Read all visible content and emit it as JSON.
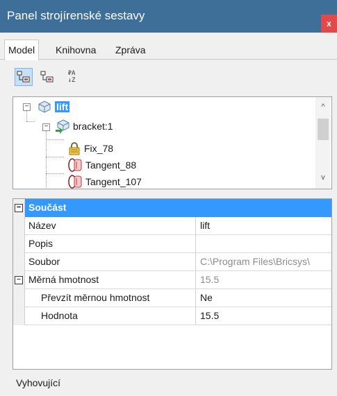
{
  "window": {
    "title": "Panel strojírenské sestavy",
    "close_label": "x",
    "colors": {
      "titlebar": "#3d6f99",
      "close": "#e04a4a",
      "selection": "#3399ff"
    }
  },
  "tabs": [
    {
      "label": "Model",
      "active": true
    },
    {
      "label": "Knihovna",
      "active": false
    },
    {
      "label": "Zpráva",
      "active": false
    }
  ],
  "toolbar": {
    "buttons": [
      {
        "icon": "tree-view-icon",
        "active": true
      },
      {
        "icon": "tree-view-alt-icon",
        "active": false
      },
      {
        "icon": "sort-az-icon",
        "active": false
      }
    ],
    "sort_glyph_top": "₽A",
    "sort_glyph_bottom": "↓Z"
  },
  "tree": {
    "nodes": [
      {
        "label": "lift",
        "icon": "assembly-icon",
        "selected": true
      },
      {
        "label": "bracket:1",
        "icon": "component-insert-icon",
        "selected": false
      },
      {
        "label": "Fix_78",
        "icon": "lock-constraint-icon",
        "selected": false
      },
      {
        "label": "Tangent_88",
        "icon": "tangent-constraint-icon",
        "selected": false
      },
      {
        "label": "Tangent_107",
        "icon": "tangent-constraint-icon",
        "selected": false
      }
    ],
    "expander_symbol": "−",
    "scroll_up": "^",
    "scroll_down": "v"
  },
  "properties": {
    "section_title": "Součást",
    "collapse_symbol": "−",
    "rows": [
      {
        "name": "Název",
        "value": "lift"
      },
      {
        "name": "Popis",
        "value": ""
      },
      {
        "name": "Soubor",
        "value": "C:\\Program Files\\Bricsys\\"
      },
      {
        "name": "Měrná hmotnost",
        "value": "15.5"
      },
      {
        "name": "Převzít měrnou hmotnost",
        "value": "Ne"
      },
      {
        "name": "Hodnota",
        "value": "15.5"
      }
    ]
  },
  "status": {
    "text": "Vyhovující"
  }
}
